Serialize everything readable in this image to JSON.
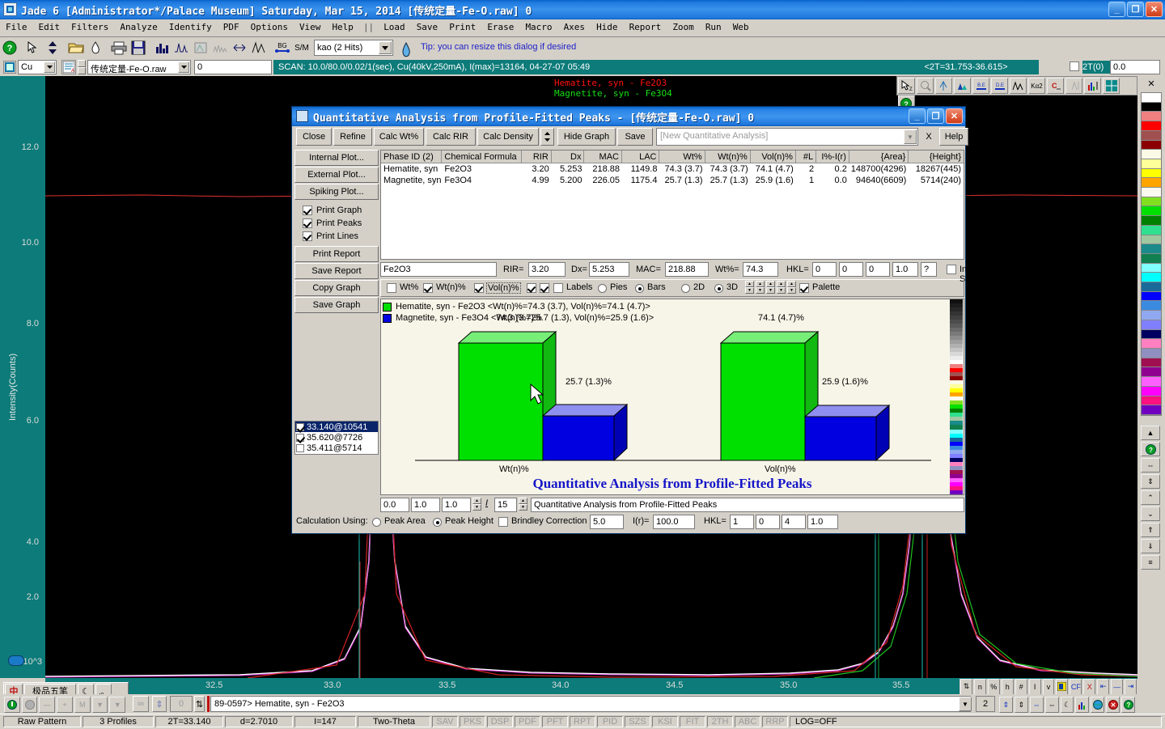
{
  "app": {
    "title": "Jade 6 [Administrator*/Palace Museum]  Saturday, Mar 15, 2014  [传统定量-Fe-O.raw]  0",
    "window_buttons": {
      "minimize": "_",
      "maximize": "❐",
      "close": "✕"
    }
  },
  "menu": {
    "items_left": [
      "File",
      "Edit",
      "Filters",
      "Analyze",
      "Identify",
      "PDF",
      "Options",
      "View",
      "Help"
    ],
    "separator": "||",
    "items_right": [
      "Load",
      "Save",
      "Print",
      "Erase",
      "Macro",
      "Axes",
      "Hide",
      "Report",
      "Zoom",
      "Run",
      "Web"
    ]
  },
  "toolbar": {
    "icons": [
      "help-icon",
      "pointer-icon",
      "updown-icon",
      "open-folder-icon",
      "drop-icon",
      "print-icon",
      "save-icon",
      "bar-chart-icon",
      "waveform-icon",
      "refine-icon",
      "multi-peak-icon",
      "expand-icon",
      "peaks-icon",
      "bg-icon",
      "sm-icon",
      "globe-icon"
    ],
    "phase_combo": "kao (2 Hits)",
    "tip": "Tip: you can resize this dialog if desired"
  },
  "toolbar2": {
    "element": "Cu",
    "file_combo": "传统定量-Fe-O.raw",
    "index": "0",
    "scan_info": "SCAN: 10.0/80.0/0.02/1(sec), Cu(40kV,250mA), I(max)=13164, 04-27-07 05:49",
    "range": "<2T=31.753-36.615>",
    "two_theta_label": "2T(0)",
    "two_theta_value": "0.0"
  },
  "right_toolbar": {
    "icons": [
      "zoom-select-icon",
      "magnifier-icon",
      "peak-find-icon",
      "peak-fill-icon",
      "be-icon",
      "de-icon",
      "peaks-icon",
      "kalpha2-icon",
      "crystallinity-icon",
      "scale-icon",
      "bar-scale-icon",
      "grid-icon",
      "help-icon"
    ]
  },
  "plot": {
    "ylabel": "Intensity(Counts)",
    "y_exponent": "x10^3",
    "y_ticks": [
      "12.0",
      "10.0",
      "8.0",
      "6.0",
      "4.0",
      "2.0"
    ],
    "x_ticks": [
      "32.5",
      "33.0",
      "33.5",
      "34.0",
      "34.5",
      "35.0",
      "35.5"
    ],
    "phase_labels": [
      {
        "text": "Hematite, syn - Fe2O3",
        "color": "#ff1010"
      },
      {
        "text": "Magnetite, syn - Fe3O4",
        "color": "#14e014"
      }
    ]
  },
  "dialog": {
    "title": "Quantitative Analysis from Profile-Fitted Peaks - [传统定量-Fe-O.raw]  0",
    "window_buttons": {
      "minimize": "_",
      "maximize": "❐",
      "close": "✕"
    },
    "toolbar_buttons": [
      "Close",
      "Refine",
      "Calc Wt%",
      "Calc RIR",
      "Calc Density"
    ],
    "hide_graph": "Hide Graph",
    "save": "Save",
    "analysis_combo_placeholder": "[New Quantitative Analysis]",
    "close_x": "X",
    "help": "Help",
    "left_panel": {
      "buttons_top": [
        "Internal Plot...",
        "External Plot...",
        "Spiking Plot..."
      ],
      "checkboxes": [
        {
          "label": "Print Graph",
          "checked": true
        },
        {
          "label": "Print Peaks",
          "checked": true
        },
        {
          "label": "Print Lines",
          "checked": true
        }
      ],
      "buttons_bottom": [
        "Print Report",
        "Save Report",
        "Copy Graph",
        "Save Graph"
      ],
      "peak_list": [
        {
          "label": "33.140@10541",
          "checked": true,
          "selected": true
        },
        {
          "label": "35.620@7726",
          "checked": true,
          "selected": false
        },
        {
          "label": "35.411@5714",
          "checked": false,
          "selected": false
        }
      ]
    },
    "table": {
      "headers": [
        "Phase ID (2)",
        "Chemical Formula",
        "RIR",
        "Dx",
        "MAC",
        "LAC",
        "Wt%",
        "Wt(n)%",
        "Vol(n)%",
        "#L",
        "I%-I(r)",
        "{Area}",
        "{Height}"
      ],
      "rows": [
        {
          "phase": "Hematite, syn",
          "formula": "Fe2O3",
          "rir": "3.20",
          "dx": "5.253",
          "mac": "218.88",
          "lac": "1149.8",
          "wt": "74.3 (3.7)",
          "wtn": "74.3 (3.7)",
          "voln": "74.1 (4.7)",
          "layers": "2",
          "irel": "0.2",
          "area": "148700(4296)",
          "height": "18267(445)"
        },
        {
          "phase": "Magnetite, syn",
          "formula": "Fe3O4",
          "rir": "4.99",
          "dx": "5.200",
          "mac": "226.05",
          "lac": "1175.4",
          "wt": "25.7 (1.3)",
          "wtn": "25.7 (1.3)",
          "voln": "25.9 (1.6)",
          "layers": "1",
          "irel": "0.0",
          "area": "94640(6609)",
          "height": "5714(240)"
        }
      ]
    },
    "detail_row": {
      "formula": "Fe2O3",
      "rir_label": "RIR=",
      "rir": "3.20",
      "dx_label": "Dx=",
      "dx": "5.253",
      "mac_label": "MAC=",
      "mac": "218.88",
      "wt_label": "Wt%=",
      "wt": "74.3",
      "hkl_label": "HKL=",
      "hkl_h": "0",
      "hkl_k": "0",
      "hkl_l": "0",
      "hkl_m": "1.0",
      "query": "?",
      "internal_standard": "Internal Standard",
      "internal_standard_checked": false
    },
    "options_row": {
      "wt_pct": {
        "label": "Wt%",
        "checked": false
      },
      "wtn_pct": {
        "label": "Wt(n)%",
        "checked": true
      },
      "voln_pct": {
        "label": "Vol(n)%",
        "checked": true
      },
      "extra1_checked": true,
      "extra2_checked": true,
      "labels": {
        "label": "Labels",
        "checked": false
      },
      "pies": {
        "label": "Pies",
        "selected": false
      },
      "bars": {
        "label": "Bars",
        "selected": true
      },
      "two_d": {
        "label": "2D",
        "selected": false
      },
      "three_d": {
        "label": "3D",
        "selected": true
      },
      "palette": {
        "label": "Palette",
        "checked": true
      }
    },
    "footer": {
      "val1": "0.0",
      "val2": "1.0",
      "val3": "1.0",
      "italic_i": "I",
      "font_size": "15",
      "caption": "Quantitative Analysis from Profile-Fitted Peaks",
      "calc_using_label": "Calculation Using:",
      "peak_area": {
        "label": "Peak Area",
        "selected": false
      },
      "peak_height": {
        "label": "Peak Height",
        "selected": true
      },
      "brindley": {
        "label": "Brindley Correction",
        "checked": false,
        "value": "5.0"
      },
      "ir_label": "I(r)=",
      "ir_value": "100.0",
      "hkl_label": "HKL=",
      "hkl_h": "1",
      "hkl_k": "0",
      "hkl_l": "4",
      "hkl_m": "1.0"
    },
    "chart_title": "Quantitative Analysis from Profile-Fitted Peaks",
    "legend": [
      {
        "color": "#00e000",
        "text": "Hematite, syn - Fe2O3 <Wt(n)%=74.3 (3.7), Vol(n)%=74.1 (4.7)>"
      },
      {
        "color": "#0000e0",
        "text": "Magnetite, syn - Fe3O4 <Wt(n)%=25.7 (1.3), Vol(n)%=25.9 (1.6)>"
      }
    ]
  },
  "chart_data": {
    "type": "bar",
    "title": "Quantitative Analysis from Profile-Fitted Peaks",
    "xlabel": "",
    "ylabel": "",
    "ylim": [
      0,
      80
    ],
    "grid": false,
    "legend_position": "top-left",
    "three_d": true,
    "categories": [
      "Wt(n)%",
      "Vol(n)%"
    ],
    "series": [
      {
        "name": "Hematite, syn - Fe2O3",
        "color": "#00e000",
        "values": [
          74.3,
          74.1
        ],
        "labels": [
          "74.3 (3.7)%",
          "74.1 (4.7)%"
        ]
      },
      {
        "name": "Magnetite, syn - Fe3O4",
        "color": "#0000e0",
        "values": [
          25.7,
          25.9
        ],
        "labels": [
          "25.7 (1.3)%",
          "25.9 (1.6)%"
        ]
      }
    ]
  },
  "status": {
    "record": "89-0597> Hematite, syn - Fe2O3",
    "page_number": "2",
    "cells": [
      "Raw Pattern",
      "3 Profiles",
      "2T=33.140",
      "d=2.7010",
      "I=147",
      "Two-Theta"
    ],
    "flags": [
      "SAV",
      "PKS",
      "DSP",
      "PDF",
      "PFT",
      "RPT",
      "PID",
      "SZS",
      "KSI",
      "FIT",
      "2TH",
      "ABC",
      "RRP"
    ],
    "log": "LOG=OFF",
    "spin_value": "0"
  },
  "ime": {
    "mode": "中",
    "name": "极品五笔",
    "icons": [
      "moon-icon",
      "punctuation-icon",
      "keyboard-icon"
    ]
  },
  "colors": {
    "titlebar_blue": "#1f78dd",
    "teal": "#0c7b79",
    "dialog_face": "#d4d0c8",
    "chart_bg": "#f7f5e8",
    "green_bar": "#00e000",
    "blue_bar": "#0000e0",
    "title_text_blue": "#1515c8"
  }
}
